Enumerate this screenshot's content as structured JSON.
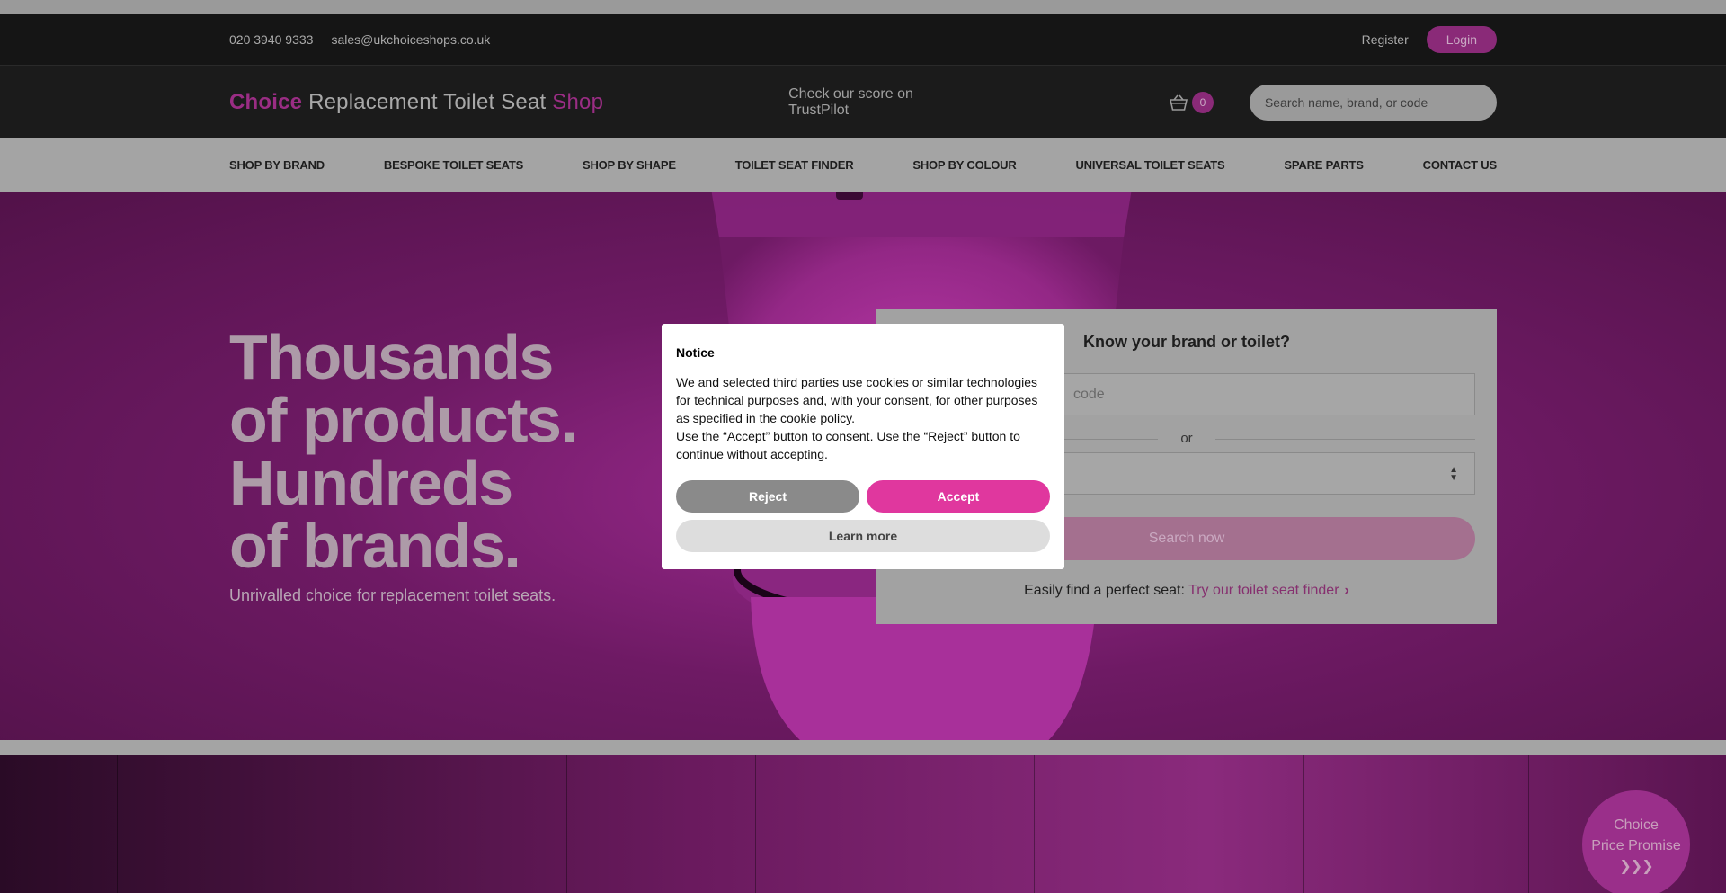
{
  "topbar": {
    "phone": "020 3940 9333",
    "email": "sales@ukchoiceshops.co.uk",
    "register": "Register",
    "login": "Login"
  },
  "header": {
    "logo_choice": "Choice",
    "logo_middle": " Replacement Toilet Seat ",
    "logo_shop": "Shop",
    "trustpilot": "Check our score on TrustPilot",
    "basket_count": "0",
    "search_placeholder": "Search name, brand, or code"
  },
  "nav": {
    "items": [
      "SHOP BY BRAND",
      "BESPOKE TOILET SEATS",
      "SHOP BY SHAPE",
      "TOILET SEAT FINDER",
      "SHOP BY COLOUR",
      "UNIVERSAL TOILET SEATS",
      "SPARE PARTS",
      "CONTACT US"
    ]
  },
  "hero": {
    "headline": [
      "Thousands",
      "of products.",
      "Hundreds",
      "of brands."
    ],
    "subtitle": "Unrivalled choice for replacement toilet seats."
  },
  "finder": {
    "title": "Know your brand or toilet?",
    "field_visible_text": "code",
    "or": "or",
    "button": "Search now",
    "link_prefix": "Easily find a perfect seat: ",
    "link_text": "Try our toilet seat finder"
  },
  "promise": {
    "line1": "Choice",
    "line2": "Price Promise",
    "arrows": "❯❯❯"
  },
  "modal": {
    "title": "Notice",
    "text_part1": "We and selected third parties use cookies or similar technologies for technical purposes and, with your consent, for other purposes as specified in the ",
    "policy_link": "cookie policy",
    "text_part2": ".",
    "text_part3": "Use the “Accept” button to consent. Use the “Reject” button to continue without accepting.",
    "reject": "Reject",
    "accept": "Accept",
    "learn_more": "Learn more"
  },
  "colors": {
    "brand_pink": "#e0379e",
    "overlay_brand": "#8a2a78"
  }
}
